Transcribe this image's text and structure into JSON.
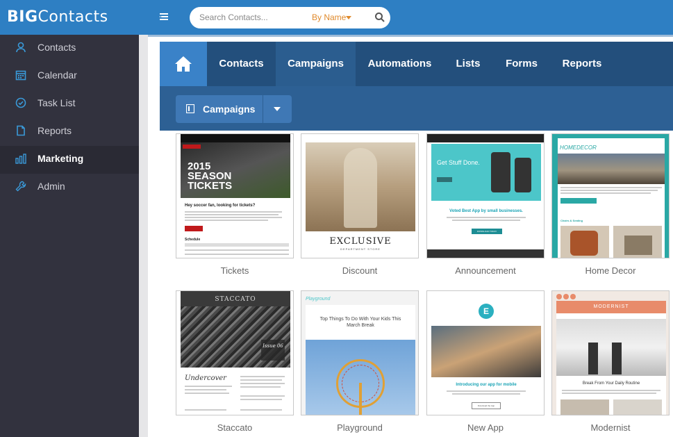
{
  "app": {
    "logo_bold": "BIG",
    "logo_rest": "Contacts"
  },
  "search": {
    "placeholder": "Search Contacts...",
    "by": "By Name"
  },
  "sidebar": {
    "items": [
      {
        "label": "Contacts",
        "icon": "user-icon"
      },
      {
        "label": "Calendar",
        "icon": "calendar-icon"
      },
      {
        "label": "Task List",
        "icon": "check-circle-icon"
      },
      {
        "label": "Reports",
        "icon": "document-icon"
      },
      {
        "label": "Marketing",
        "icon": "bar-chart-icon",
        "active": true
      },
      {
        "label": "Admin",
        "icon": "wrench-icon"
      }
    ]
  },
  "nav": {
    "tabs": [
      {
        "label": "Contacts"
      },
      {
        "label": "Campaigns",
        "active": true
      },
      {
        "label": "Automations"
      },
      {
        "label": "Lists"
      },
      {
        "label": "Forms"
      },
      {
        "label": "Reports"
      }
    ]
  },
  "subnav": {
    "button_label": "Campaigns"
  },
  "templates": [
    {
      "name": "Tickets",
      "headline": "2015 SEASON TICKETS",
      "body_title": "Hey soccer fan, looking for tickets?",
      "section": "Schedule"
    },
    {
      "name": "Discount",
      "headline": "EXCLUSIVE",
      "sub": "DEPARTMENT STORE"
    },
    {
      "name": "Announcement",
      "headline": "Get Stuff Done.",
      "body_title": "Voted Best App by small businesses.",
      "button": "DOWNLOAD TODAY"
    },
    {
      "name": "Home Decor",
      "headline": "HOMEDECOR",
      "section": "Chairs & Seating"
    },
    {
      "name": "Staccato",
      "headline": "STACCATO",
      "body_title": "Undercover",
      "badge": "Issue 06"
    },
    {
      "name": "Playground",
      "headline": "Playground",
      "body_title": "Top Things To Do With Your Kids This March Break"
    },
    {
      "name": "New App",
      "headline": "E",
      "body_title": "Introducing our app for mobile",
      "button": "Download the App"
    },
    {
      "name": "Modernist",
      "headline": "MODERNIST",
      "body_title": "Break From Your Daily Routine"
    }
  ],
  "colors": {
    "topbar": "#2e7fc3",
    "sidebar": "#32323e",
    "nav": "#234f7c",
    "subnav": "#2d6094",
    "accent_orange": "#e08a2c"
  }
}
